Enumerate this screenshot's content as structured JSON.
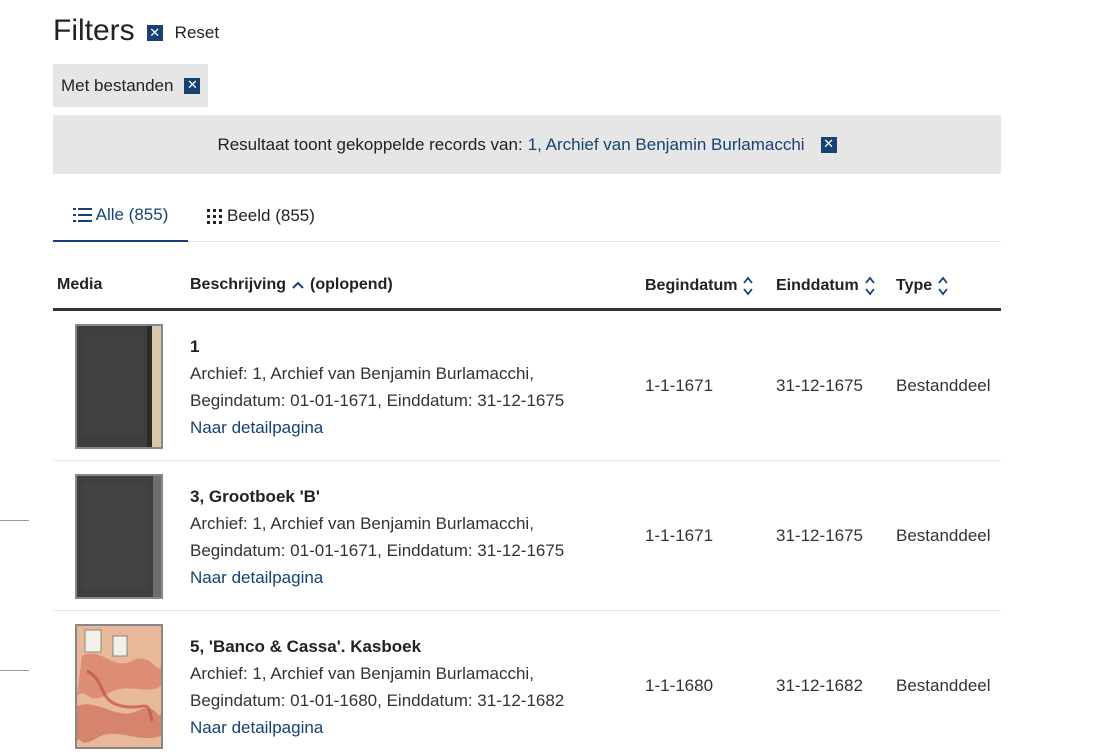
{
  "filters": {
    "title": "Filters",
    "reset_label": "Reset",
    "active_chip": "Met bestanden"
  },
  "banner": {
    "text": "Resultaat toont gekoppelde records van:",
    "link": "1, Archief van Benjamin Burlamacchi"
  },
  "tabs": [
    {
      "label": "Alle (855)",
      "icon": "list-icon",
      "active": true
    },
    {
      "label": "Beeld (855)",
      "icon": "grid-icon",
      "active": false
    }
  ],
  "table": {
    "headers": {
      "media": "Media",
      "description": "Beschrijving",
      "description_sort": "(oplopend)",
      "begin": "Begindatum",
      "end": "Einddatum",
      "type": "Type"
    },
    "rows": [
      {
        "title": "1",
        "archive": "Archief: 1, Archief van Benjamin Burlamacchi,",
        "dates": "Begindatum: 01-01-1671, Einddatum: 31-12-1675",
        "link": "Naar detailpagina",
        "begin": "1-1-1671",
        "end": "31-12-1675",
        "type": "Bestanddeel",
        "thumb": "grey-ledger"
      },
      {
        "title": "3, Grootboek 'B'",
        "archive": "Archief: 1, Archief van Benjamin Burlamacchi,",
        "dates": "Begindatum: 01-01-1671, Einddatum: 31-12-1675",
        "link": "Naar detailpagina",
        "begin": "1-1-1671",
        "end": "31-12-1675",
        "type": "Bestanddeel",
        "thumb": "grey-ledger"
      },
      {
        "title": "5, 'Banco & Cassa'. Kasboek",
        "archive": "Archief: 1, Archief van Benjamin Burlamacchi,",
        "dates": "Begindatum: 01-01-1680, Einddatum: 31-12-1682",
        "link": "Naar detailpagina",
        "begin": "1-1-1680",
        "end": "31-12-1682",
        "type": "Bestanddeel",
        "thumb": "marbled-book"
      }
    ]
  },
  "colors": {
    "accent": "#154273",
    "panel_bg": "#e6e6e6",
    "text": "#333333"
  }
}
